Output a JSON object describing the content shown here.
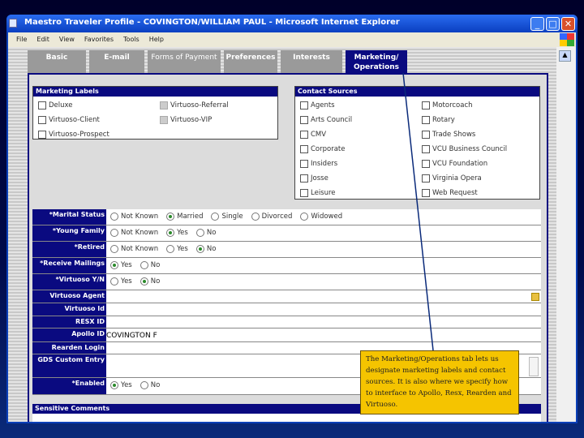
{
  "window": {
    "title": "Maestro Traveler Profile - COVINGTON/WILLIAM PAUL - Microsoft Internet Explorer"
  },
  "menu": [
    "File",
    "Edit",
    "View",
    "Favorites",
    "Tools",
    "Help"
  ],
  "tabs": [
    {
      "label": "Basic"
    },
    {
      "label": "E-mail"
    },
    {
      "label": "Forms of Payment"
    },
    {
      "label": "Preferences"
    },
    {
      "label": "Interests"
    },
    {
      "label": "Marketing/ Operations",
      "active": true
    }
  ],
  "marketing_labels": {
    "title": "Marketing Labels",
    "items": [
      {
        "label": "Deluxe",
        "checked": false
      },
      {
        "label": "Virtuoso-Client",
        "checked": false
      },
      {
        "label": "Virtuoso-Prospect",
        "checked": false
      },
      {
        "label": "Virtuoso-Referral",
        "checked": false,
        "disabled": true
      },
      {
        "label": "Virtuoso-VIP",
        "checked": false,
        "disabled": true
      }
    ]
  },
  "contact_sources": {
    "title": "Contact Sources",
    "items": [
      "Agents",
      "Arts Council",
      "CMV",
      "Corporate",
      "Insiders",
      "Josse",
      "Leisure",
      "Motorcoach",
      "Rotary",
      "Trade Shows",
      "VCU Business Council",
      "VCU Foundation",
      "Virginia Opera",
      "Web Request"
    ]
  },
  "fields": [
    {
      "label": "*Marital Status",
      "options": [
        "Not Known",
        "Married",
        "Single",
        "Divorced",
        "Widowed"
      ],
      "selected": "Married"
    },
    {
      "label": "*Young Family",
      "options": [
        "Not Known",
        "Yes",
        "No"
      ],
      "selected": "Yes"
    },
    {
      "label": "*Retired",
      "options": [
        "Not Known",
        "Yes",
        "No"
      ],
      "selected": "No"
    },
    {
      "label": "*Receive Mailings",
      "options": [
        "Yes",
        "No"
      ],
      "selected": "Yes"
    },
    {
      "label": "*Virtuoso Y/N",
      "options": [
        "Yes",
        "No"
      ],
      "selected": "No"
    },
    {
      "label": "Virtuoso Agent",
      "value": ""
    },
    {
      "label": "Virtuoso Id",
      "value": ""
    },
    {
      "label": "RESX ID",
      "value": ""
    },
    {
      "label": "Apollo ID",
      "value": "COVINGTON F"
    },
    {
      "label": "Rearden Login",
      "value": ""
    },
    {
      "label": "GDS Custom Entry",
      "value": ""
    },
    {
      "label": "*Enabled",
      "options": [
        "Yes",
        "No"
      ],
      "selected": "Yes"
    }
  ],
  "sensitive_comments": {
    "title": "Sensitive Comments"
  },
  "callout": {
    "text": "The Marketing/Operations tab lets us designate marketing labels and contact sources. It is also where we specify how to interface to Apollo, Resx, Rearden and Virtuoso."
  }
}
